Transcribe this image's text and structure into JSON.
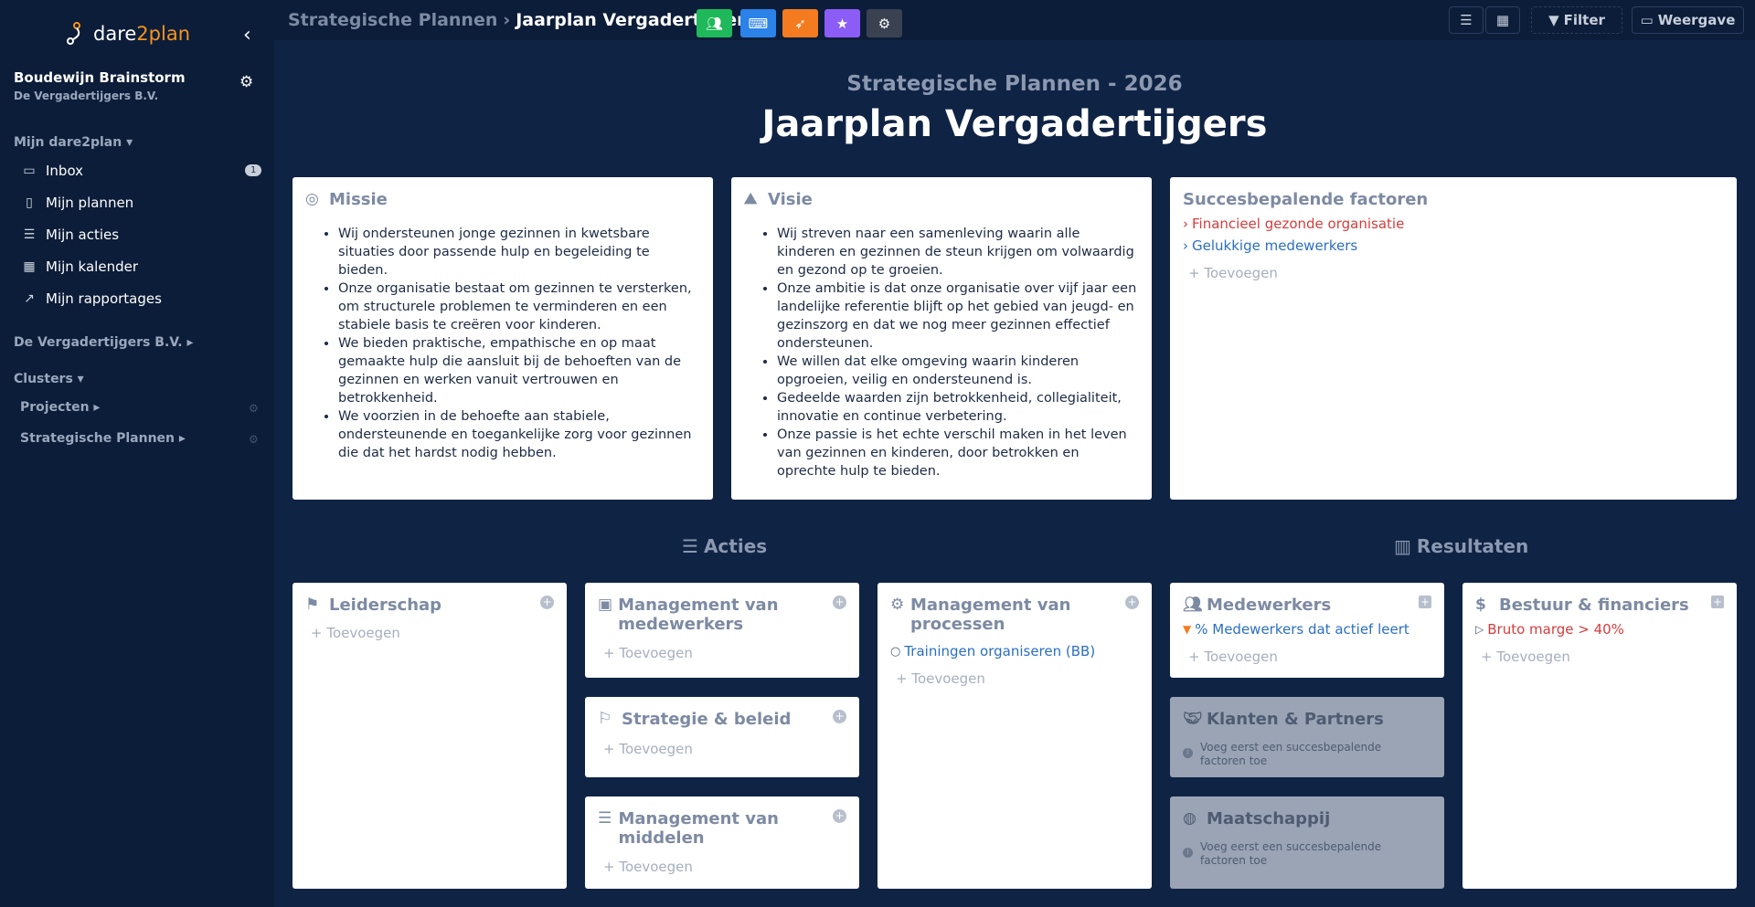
{
  "sidebar": {
    "logo_text_1": "dare",
    "logo_text_2": "2plan",
    "user_name": "Boudewijn Brainstorm",
    "user_org": "De Vergadertijgers B.V.",
    "section_mine": "Mijn dare2plan ▾",
    "items": [
      {
        "label": "Inbox",
        "icon": "inbox-icon",
        "badge": "1"
      },
      {
        "label": "Mijn plannen",
        "icon": "file-icon"
      },
      {
        "label": "Mijn acties",
        "icon": "list-icon"
      },
      {
        "label": "Mijn kalender",
        "icon": "calendar-icon"
      },
      {
        "label": "Mijn rapportages",
        "icon": "chart-line-icon"
      }
    ],
    "section_org": "De Vergadertijgers B.V. ▸",
    "section_clusters": "Clusters ▾",
    "clusters": [
      {
        "label": "Projecten ▸"
      },
      {
        "label": "Strategische Plannen ▸"
      }
    ]
  },
  "topbar": {
    "breadcrumb_parent": "Strategische Plannen",
    "breadcrumb_current": "Jaarplan Vergadertijgers",
    "filter_label": "Filter",
    "view_label": "Weergave",
    "colors": {
      "green": "#1fb85a",
      "blue": "#2b82e8",
      "orange": "#f47b20",
      "purple": "#8b5cf6",
      "dark": "#3a4252"
    }
  },
  "plan": {
    "subtitle": "Strategische Plannen - 2026",
    "title": "Jaarplan Vergadertijgers"
  },
  "missie": {
    "title": "Missie",
    "bullets": [
      "Wij ondersteunen jonge gezinnen in kwetsbare situaties door passende hulp en begeleiding te bieden.",
      "Onze organisatie bestaat om gezinnen te versterken, om structurele problemen te verminderen en een stabiele basis te creëren voor kinderen.",
      "We bieden praktische, empathische en op maat gemaakte hulp die aansluit bij de behoeften van de gezinnen en werken vanuit vertrouwen en betrokkenheid.",
      "We voorzien in de behoefte aan stabiele, ondersteunende en toegankelijke zorg voor gezinnen die dat het hardst nodig hebben."
    ]
  },
  "visie": {
    "title": "Visie",
    "bullets": [
      "Wij streven naar een samenleving waarin alle kinderen en gezinnen de steun krijgen om volwaardig en gezond op te groeien.",
      "Onze ambitie is dat onze organisatie over vijf jaar een landelijke referentie blijft op het gebied van jeugd- en gezinszorg en dat we nog meer gezinnen effectief ondersteunen.",
      "We willen dat elke omgeving waarin kinderen opgroeien, veilig en ondersteunend is.",
      "Gedeelde waarden zijn betrokkenheid, collegialiteit, innovatie en continue verbetering.",
      "Onze passie is het echte verschil maken in het leven van gezinnen en kinderen, door betrokken en oprechte hulp te bieden."
    ]
  },
  "sbf": {
    "title": "Succesbepalende factoren",
    "items": [
      {
        "label": "Financieel gezonde organisatie",
        "color": "#d63c3c"
      },
      {
        "label": "Gelukkige medewerkers",
        "color": "#2b6fc2"
      }
    ],
    "add_label": "Toevoegen"
  },
  "acties": {
    "heading": "Acties",
    "leiderschap": "Leiderschap",
    "mgmt_medewerkers": "Management van medewerkers",
    "strategie": "Strategie & beleid",
    "mgmt_middelen": "Management van middelen",
    "mgmt_processen": "Management van processen",
    "processen_item": "Trainingen organiseren (BB)"
  },
  "resultaten": {
    "heading": "Resultaten",
    "medewerkers": "Medewerkers",
    "medewerkers_item": "% Medewerkers dat actief leert",
    "klanten": "Klanten & Partners",
    "maatschappij": "Maatschappij",
    "bestuur": "Bestuur & financiers",
    "bestuur_item": "Bruto marge > 40%",
    "note": "Voeg eerst een succesbepalende factoren toe"
  },
  "common": {
    "add": "Toevoegen"
  }
}
